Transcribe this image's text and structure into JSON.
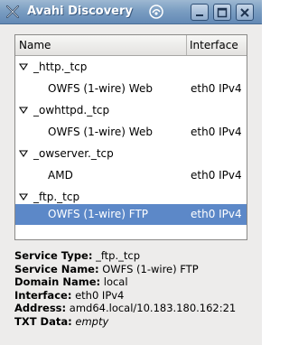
{
  "window": {
    "title": "Avahi Discovery"
  },
  "tree": {
    "columns": [
      "Name",
      "Interface"
    ],
    "groups": [
      {
        "type": "_http._tcp",
        "services": [
          {
            "name": "OWFS (1-wire) Web",
            "interface": "eth0 IPv4"
          }
        ]
      },
      {
        "type": "_owhttpd._tcp",
        "services": [
          {
            "name": "OWFS (1-wire) Web",
            "interface": "eth0 IPv4"
          }
        ]
      },
      {
        "type": "_owserver._tcp",
        "services": [
          {
            "name": "AMD",
            "interface": "eth0 IPv4"
          }
        ]
      },
      {
        "type": "_ftp._tcp",
        "services": [
          {
            "name": "OWFS (1-wire) FTP",
            "interface": "eth0 IPv4",
            "selected": true
          }
        ]
      }
    ]
  },
  "details": {
    "service_type_label": "Service Type:",
    "service_type": "_ftp._tcp",
    "service_name_label": "Service Name:",
    "service_name": "OWFS (1-wire) FTP",
    "domain_name_label": "Domain Name:",
    "domain_name": "local",
    "interface_label": "Interface:",
    "interface": "eth0 IPv4",
    "address_label": "Address:",
    "address": "amd64.local/10.183.180.162:21",
    "txt_data_label": "TXT Data:",
    "txt_data": "empty"
  },
  "colors": {
    "selection": "#5c88c8",
    "titlebar": "#7b9ec2"
  }
}
